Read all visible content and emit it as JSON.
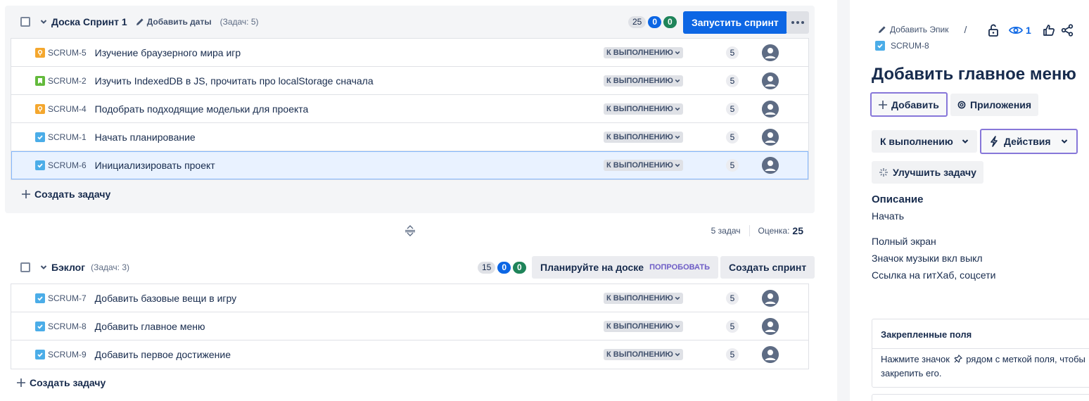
{
  "sprint": {
    "title": "Доска Спринт 1",
    "add_dates": "Добавить даты",
    "task_count": "(Задач: 5)",
    "badge_total": "25",
    "badge_blue": "0",
    "badge_green": "0",
    "start_button": "Запустить спринт",
    "issues": [
      {
        "type": "bug",
        "key": "SCRUM-5",
        "summary": "Изучение браузерного мира игр",
        "status": "К ВЫПОЛНЕНИЮ",
        "points": "5"
      },
      {
        "type": "story",
        "key": "SCRUM-2",
        "summary": "Изучить IndexedDB в JS, прочитать про localStorage сначала",
        "status": "К ВЫПОЛНЕНИЮ",
        "points": "5"
      },
      {
        "type": "bug",
        "key": "SCRUM-4",
        "summary": "Подобрать подходящие модельки для проекта",
        "status": "К ВЫПОЛНЕНИЮ",
        "points": "5"
      },
      {
        "type": "task",
        "key": "SCRUM-1",
        "summary": "Начать планирование",
        "status": "К ВЫПОЛНЕНИЮ",
        "points": "5"
      },
      {
        "type": "task",
        "key": "SCRUM-6",
        "summary": "Инициализировать проект",
        "status": "К ВЫПОЛНЕНИЮ",
        "points": "5"
      }
    ],
    "create_task": "Создать задачу"
  },
  "sprint_summary": {
    "tasks": "5 задач",
    "estimate_label": "Оценка:",
    "estimate_value": "25"
  },
  "backlog": {
    "title": "Бэклог",
    "task_count": "(Задач: 3)",
    "badge_total": "15",
    "badge_blue": "0",
    "badge_green": "0",
    "plan_button": "Планируйте на доске",
    "try_label": "ПОПРОБОВАТЬ",
    "create_sprint_button": "Создать спринт",
    "issues": [
      {
        "type": "task",
        "key": "SCRUM-7",
        "summary": "Добавить базовые вещи в игру",
        "status": "К ВЫПОЛНЕНИЮ",
        "points": "5"
      },
      {
        "type": "task",
        "key": "SCRUM-8",
        "summary": "Добавить главное меню",
        "status": "К ВЫПОЛНЕНИЮ",
        "points": "5"
      },
      {
        "type": "task",
        "key": "SCRUM-9",
        "summary": "Добавить первое достижение",
        "status": "К ВЫПОЛНЕНИЮ",
        "points": "5"
      }
    ],
    "create_task": "Создать задачу"
  },
  "detail": {
    "add_epic": "Добавить Эпик",
    "separator": "/",
    "watchers": "1",
    "key": "SCRUM-8",
    "title": "Добавить главное меню",
    "add_button": "Добавить",
    "apps_button": "Приложения",
    "status_button": "К выполнению",
    "actions_button": "Действия",
    "improve_button": "Улучшить задачу",
    "description_heading": "Описание",
    "description_lines": [
      "Начать",
      "Полный экран",
      "Значок музыки вкл выкл",
      "Ссылка на гитХаб, соцсети"
    ],
    "pinned_heading": "Закрепленные поля",
    "pinned_text_before": "Нажмите значок",
    "pinned_text_after": "рядом с меткой поля, чтобы закрепить его."
  },
  "colors": {
    "primary": "#0c66e4",
    "task": "#4bade8",
    "story": "#63ba3c",
    "bug": "#f4a72e",
    "outline": "#8777d9"
  }
}
